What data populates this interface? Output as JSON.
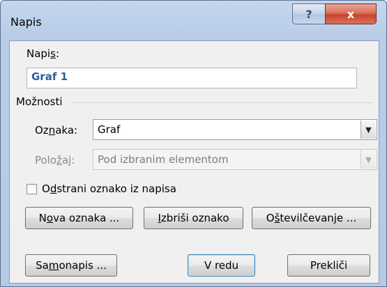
{
  "window": {
    "title": "Napis",
    "help_glyph": "?",
    "close_glyph": "x"
  },
  "caption": {
    "label_prefix": "Napi",
    "label_accel": "s",
    "label_suffix": ":",
    "value": "Graf 1"
  },
  "options": {
    "group_label": "Možnosti",
    "label_field": {
      "label_prefix": "Oz",
      "label_accel": "n",
      "label_suffix": "aka:",
      "value": "Graf"
    },
    "position_field": {
      "label_prefix": "Polo",
      "label_accel": "ž",
      "label_suffix": "aj:",
      "value": "Pod izbranim elementom",
      "enabled": false
    },
    "exclude_checkbox": {
      "label_prefix": "O",
      "label_accel": "d",
      "label_suffix": "strani oznako iz napisa",
      "checked": false
    }
  },
  "buttons": {
    "new_label": {
      "prefix": "N",
      "accel": "o",
      "suffix": "va oznaka ..."
    },
    "delete_label": {
      "prefix": "",
      "accel": "I",
      "suffix": "zbriši oznako"
    },
    "numbering": {
      "prefix": "O",
      "accel": "š",
      "suffix": "tevilčevanje ..."
    },
    "autocaption": {
      "prefix": "Sa",
      "accel": "m",
      "suffix": "onapis ..."
    },
    "ok": "V redu",
    "cancel": "Prekliči"
  },
  "icons": {
    "dropdown": "chevron-down-icon",
    "help": "help-icon",
    "close": "close-icon"
  },
  "colors": {
    "caption_text": "#2e5d9b",
    "close_button": "#c7442a"
  }
}
